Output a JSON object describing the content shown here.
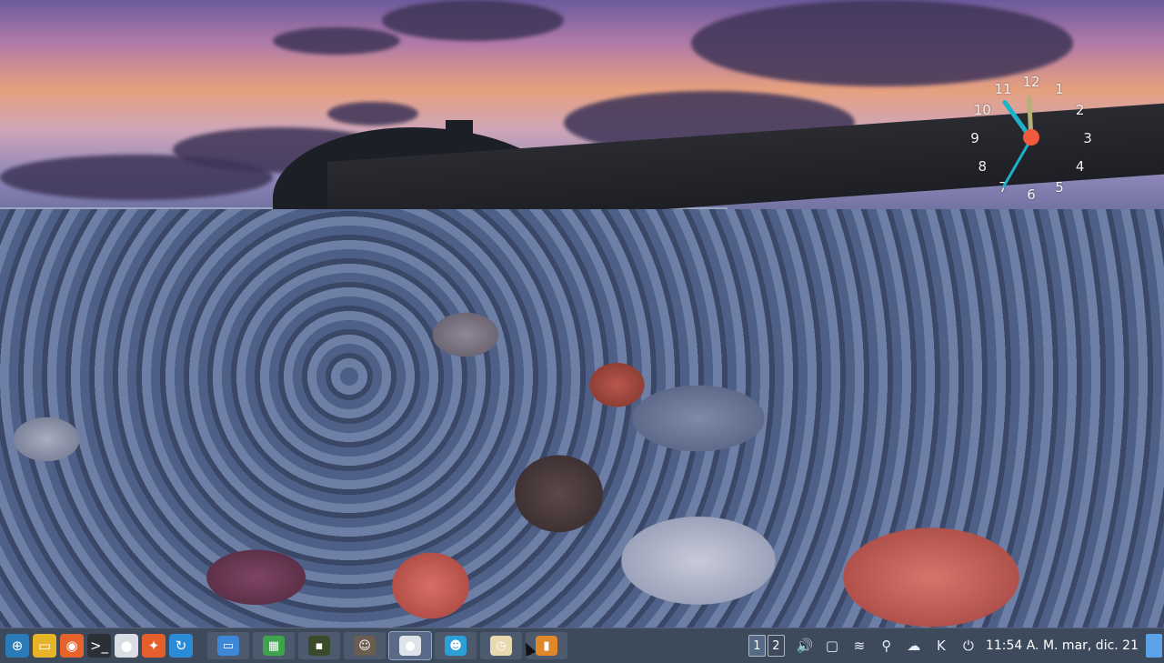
{
  "desktop": {
    "wallpaper": "pebble-beach-sunset"
  },
  "clock_widget": {
    "numbers": [
      "12",
      "1",
      "2",
      "3",
      "4",
      "5",
      "6",
      "7",
      "8",
      "9",
      "10",
      "11"
    ],
    "time": {
      "hour": 11,
      "minute": 54,
      "second": 35
    },
    "colors": {
      "hour_hand": "#b4b07a",
      "minute_hand": "#1bb3c9",
      "second_hand": "#1bb3c9",
      "center": "#f05a3c"
    }
  },
  "taskbar": {
    "launchers": [
      {
        "name": "app-menu-icon",
        "glyph": "⊕",
        "color": "#2b7bb8"
      },
      {
        "name": "file-manager-icon",
        "glyph": "▭",
        "color": "#e7b427"
      },
      {
        "name": "firefox-icon",
        "glyph": "◉",
        "color": "#e8632c"
      },
      {
        "name": "terminal-icon",
        "glyph": ">_",
        "color": "#2b2f36"
      },
      {
        "name": "sphere-icon",
        "glyph": "●",
        "color": "#d9dde4"
      },
      {
        "name": "package-manager-icon",
        "glyph": "✦",
        "color": "#e45f2b"
      },
      {
        "name": "update-manager-icon",
        "glyph": "↻",
        "color": "#2c8bd6"
      }
    ],
    "tasks": [
      {
        "name": "task-folder",
        "glyph": "▭",
        "color": "#3d87d9"
      },
      {
        "name": "task-spreadsheet",
        "glyph": "▦",
        "color": "#3fa34d"
      },
      {
        "name": "task-terminal",
        "glyph": "▪",
        "color": "#3b4a2a"
      },
      {
        "name": "task-penguin",
        "glyph": "☺",
        "color": "#6b5d4f"
      },
      {
        "name": "task-sphere",
        "glyph": "●",
        "color": "#dfe3ea",
        "active": true
      },
      {
        "name": "task-smiley",
        "glyph": "☻",
        "color": "#2aa0d6"
      },
      {
        "name": "task-clock",
        "glyph": "◷",
        "color": "#e8d9b0"
      },
      {
        "name": "task-slideshow",
        "glyph": "▮",
        "color": "#e0872b"
      }
    ],
    "workspaces": [
      "1",
      "2"
    ],
    "active_workspace": "1",
    "tray": [
      {
        "name": "volume-icon",
        "glyph": "🔊"
      },
      {
        "name": "screen-icon",
        "glyph": "▢"
      },
      {
        "name": "wifi-icon",
        "glyph": "≋"
      },
      {
        "name": "location-icon",
        "glyph": "⚲"
      },
      {
        "name": "weather-icon",
        "glyph": "☁"
      },
      {
        "name": "k-app-icon",
        "glyph": "K"
      },
      {
        "name": "power-icon",
        "glyph": "⏻"
      }
    ],
    "clock": "11:54 A. M. mar, dic. 21"
  }
}
